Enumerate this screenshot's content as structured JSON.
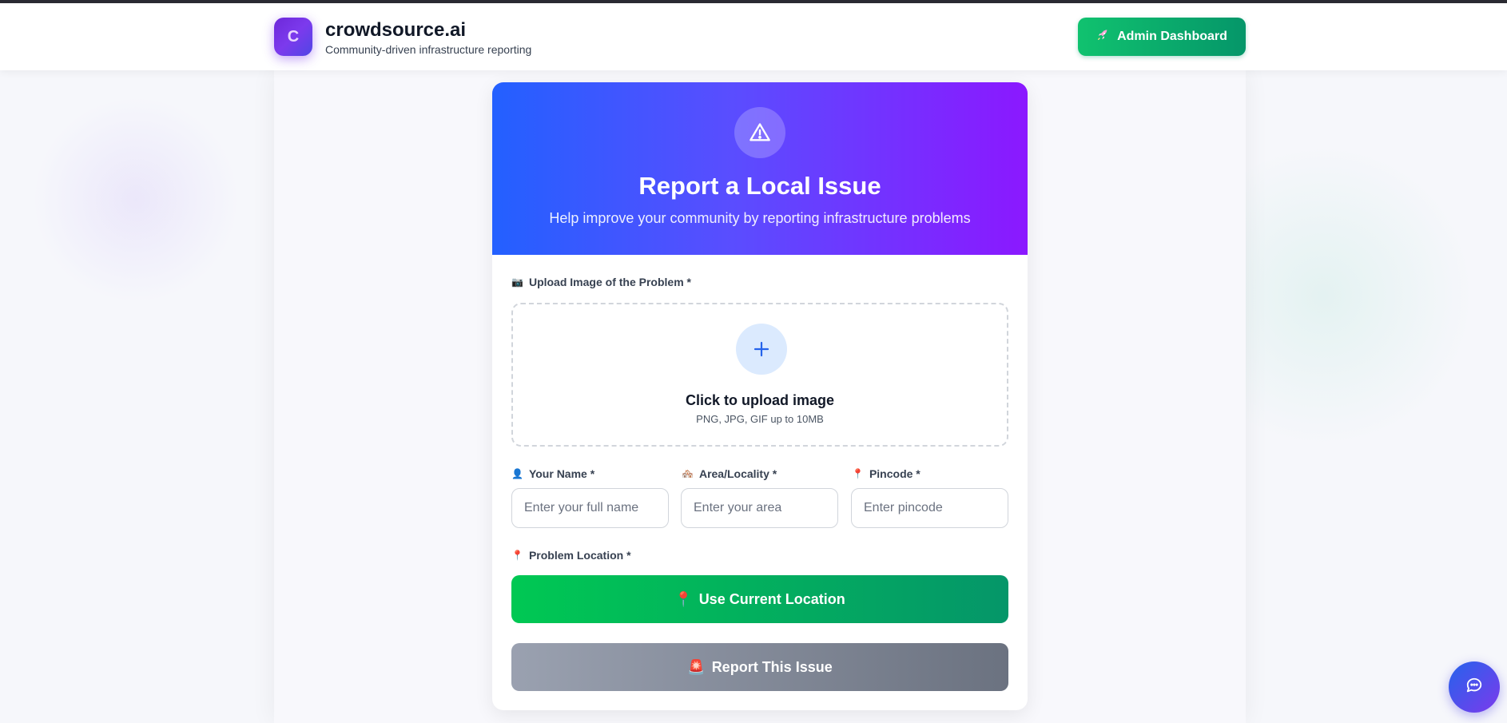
{
  "header": {
    "logo_letter": "C",
    "brand_name": "crowdsource.ai",
    "tagline": "Community-driven infrastructure reporting",
    "admin_button": {
      "icon": "rocket-icon",
      "label": "Admin Dashboard"
    }
  },
  "hero": {
    "icon": "warning-triangle-icon",
    "title": "Report a Local Issue",
    "subtitle": "Help improve your community by reporting infrastructure problems"
  },
  "form": {
    "upload": {
      "label_emoji": "📷",
      "label": "Upload Image of the Problem *",
      "title": "Click to upload image",
      "hint": "PNG, JPG, GIF up to 10MB",
      "icon": "plus-icon"
    },
    "name": {
      "emoji": "👤",
      "label": "Your Name *",
      "placeholder": "Enter your full name",
      "value": ""
    },
    "area": {
      "emoji": "🏘️",
      "label": "Area/Locality *",
      "placeholder": "Enter your area",
      "value": ""
    },
    "pincode": {
      "emoji": "📍",
      "label": "Pincode *",
      "placeholder": "Enter pincode",
      "value": ""
    },
    "location": {
      "emoji": "📍",
      "label": "Problem Location *",
      "button_emoji": "📍",
      "button_label": "Use Current Location"
    },
    "submit": {
      "emoji": "🚨",
      "label": "Report This Issue",
      "state": "disabled"
    }
  },
  "chat": {
    "icon": "chat-bubble-icon"
  },
  "colors": {
    "brand_purple": "#7c3aed",
    "hero_start": "#2360ff",
    "hero_end": "#8b18ff",
    "success_green": "#059669",
    "disabled_gray": "#6b7280"
  }
}
